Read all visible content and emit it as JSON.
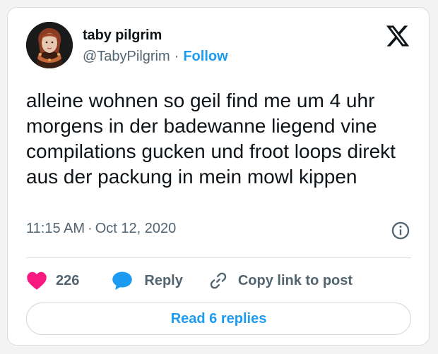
{
  "author": {
    "display_name": "taby pilgrim",
    "handle": "@TabyPilgrim",
    "follow_label": "Follow",
    "avatar_icon": "profile-portrait"
  },
  "tweet": {
    "text": "alleine wohnen so geil find me um 4 uhr morgens in der badewanne liegend vine compilations gucken und froot loops direkt aus der packung in mein mowl kippen",
    "time": "11:15 AM",
    "date": "Oct 12, 2020"
  },
  "actions": {
    "like_count": "226",
    "reply_label": "Reply",
    "copy_link_label": "Copy link to post"
  },
  "footer": {
    "read_replies_label": "Read 6 replies"
  },
  "icons": {
    "logo": "x-logo-icon",
    "info": "info-icon",
    "like": "heart-icon",
    "reply": "speech-bubble-icon",
    "copy": "link-icon"
  },
  "colors": {
    "accent": "#1d9bf0",
    "like": "#f91880",
    "text": "#0f1419",
    "muted": "#536471"
  }
}
